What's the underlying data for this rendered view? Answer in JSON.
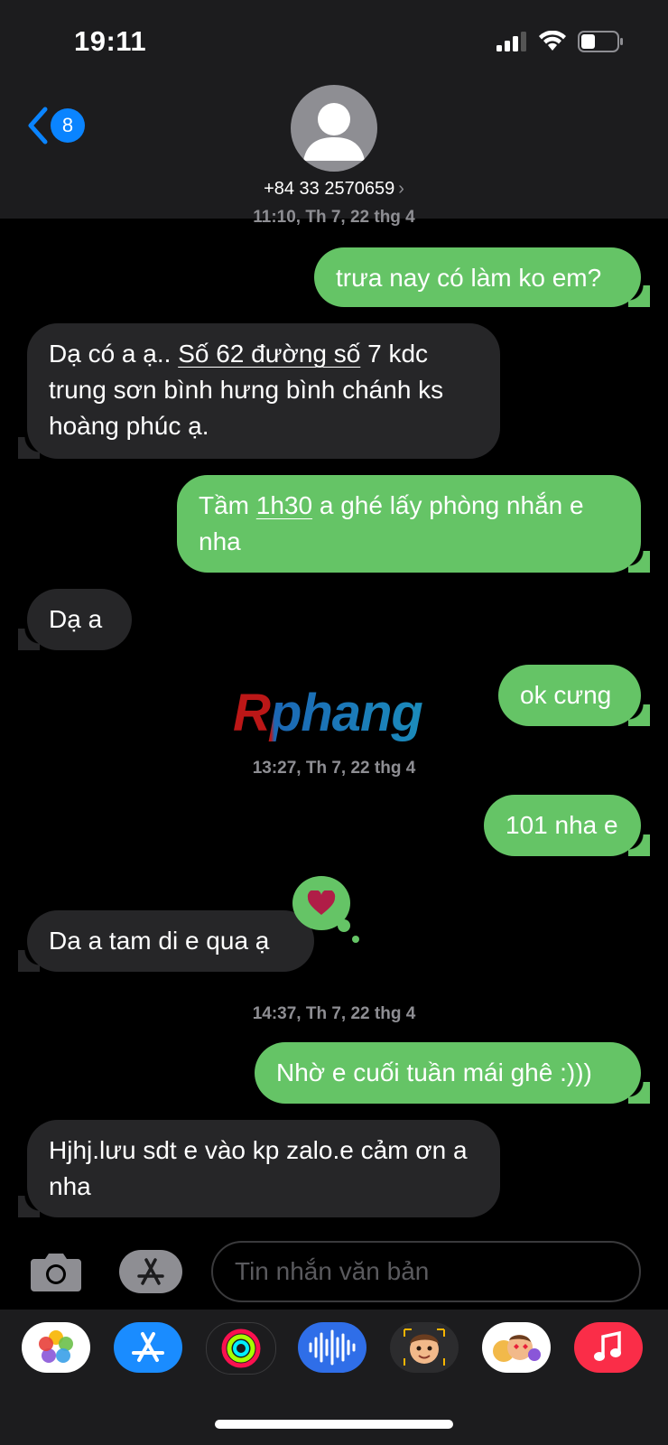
{
  "status": {
    "time": "19:11"
  },
  "header": {
    "back_badge": "8",
    "contact": "+84 33 2570659",
    "contact_chevron": "›"
  },
  "timestamps": {
    "t1": "11:10, Th 7, 22 thg 4",
    "t2": "13:27, Th 7, 22 thg 4",
    "t3": "14:37, Th 7, 22 thg 4"
  },
  "messages": {
    "m1": {
      "text": "trưa nay có làm ko em?"
    },
    "m2": {
      "pre": "Dạ có a ạ.. ",
      "link": "Số 62 đường số",
      "post": " 7 kdc trung sơn bình hưng bình chánh ks hoàng phúc ạ."
    },
    "m3": {
      "pre": "Tầm ",
      "link": "1h30",
      "post": " a ghé lấy phòng nhắn e nha"
    },
    "m4": {
      "text": "Dạ a"
    },
    "m5": {
      "text": "ok cưng"
    },
    "m6": {
      "text": "101 nha e"
    },
    "m7": {
      "text": "Da a tam di e qua ạ"
    },
    "m8": {
      "text": "Nhờ e cuối tuần mái ghê :)))"
    },
    "m9": {
      "text": "Hjhj.lưu sdt e vào kp zalo.e cảm ơn a nha"
    }
  },
  "watermark": {
    "text": "Rphang"
  },
  "reaction": {
    "icon": "heart-icon",
    "color": "#65c466"
  },
  "composer": {
    "placeholder": "Tin nhắn văn bản"
  },
  "dock": {
    "apps": [
      "photos-icon",
      "app-store-icon",
      "fitness-icon",
      "voice-memos-icon",
      "memoji-icon",
      "memoji-stickers-icon",
      "music-icon"
    ]
  },
  "colors": {
    "outgoing": "#65c466",
    "incoming": "#262628",
    "accent": "#0a84ff"
  }
}
